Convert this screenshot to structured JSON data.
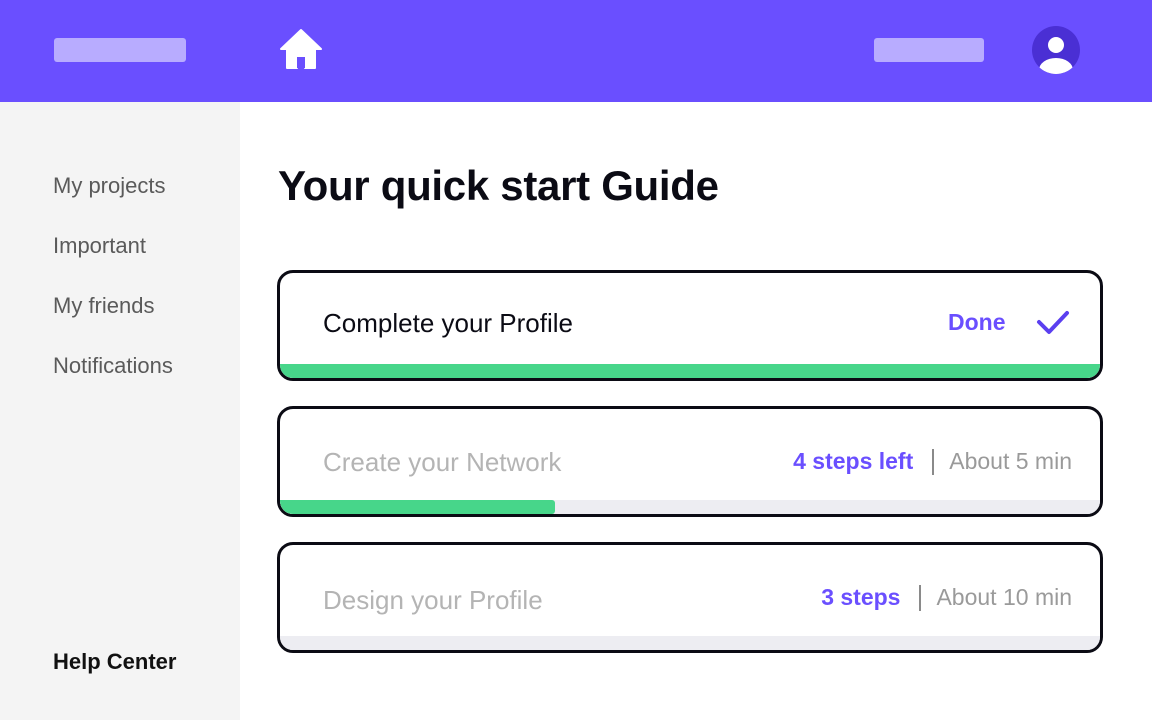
{
  "header": {
    "home_icon": "home-icon",
    "avatar_icon": "user-avatar-icon",
    "brand_color": "#6a4fff"
  },
  "sidebar": {
    "items": [
      {
        "label": "My projects"
      },
      {
        "label": "Important"
      },
      {
        "label": "My friends"
      },
      {
        "label": "Notifications"
      }
    ],
    "help_label": "Help Center"
  },
  "main": {
    "title": "Your quick start Guide",
    "tasks": [
      {
        "title": "Complete your Profile",
        "status": "Done",
        "status_icon": "checkmark-icon",
        "progress": 1.0
      },
      {
        "title": "Create your Network",
        "steps": "4 steps left",
        "time": "About 5 min",
        "progress": 0.33
      },
      {
        "title": "Design your Profile",
        "steps": "3 steps",
        "time": "About 10 min",
        "progress": 0.0
      }
    ]
  },
  "colors": {
    "accent": "#6a4fff",
    "progress": "#47d68a",
    "sidebar_bg": "#f4f4f4"
  }
}
